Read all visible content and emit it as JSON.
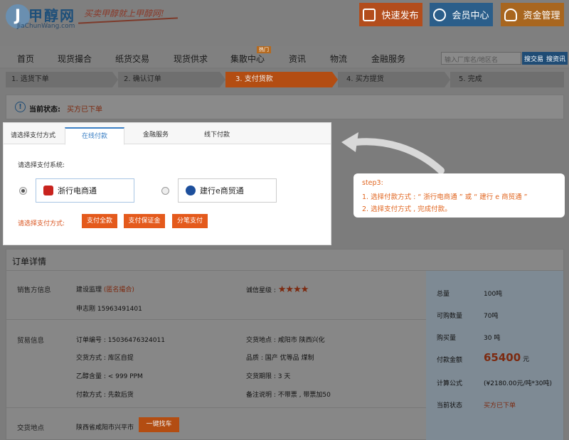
{
  "header": {
    "logo_text": "甲醇网",
    "logo_sub": "JiaChunWang.com",
    "slogan": "买卖甲醇就上甲醇网!",
    "buttons": [
      {
        "label": "快速发布"
      },
      {
        "label": "会员中心"
      },
      {
        "label": "资金管理"
      }
    ]
  },
  "nav": {
    "items": [
      "首页",
      "现货撮合",
      "纸货交易",
      "现货供求",
      "集散中心",
      "资讯",
      "物流",
      "金融服务"
    ],
    "hot_badge": "热门",
    "search_placeholder": "输入厂库名/地区名",
    "search_buttons": [
      "搜交易",
      "搜资讯"
    ]
  },
  "steps": [
    "1. 选货下单",
    "2. 确认订单",
    "3. 支付货款",
    "4. 买方提货",
    "5. 完成"
  ],
  "active_step": 3,
  "status": {
    "label": "当前状态:",
    "value": "买方已下单"
  },
  "payment": {
    "choose_label": "请选择支付方式",
    "tabs": [
      "在线付款",
      "金融服务",
      "线下付款"
    ],
    "active_tab": "在线付款",
    "system_label": "请选择支付系统:",
    "banks": [
      {
        "name": "浙行电商通",
        "selected": true
      },
      {
        "name": "建行e商贸通",
        "selected": false
      }
    ],
    "method_label": "请选择支付方式:",
    "methods": [
      "支付全款",
      "支付保证金",
      "分笔支付"
    ]
  },
  "callout": {
    "title": "step3:",
    "line1": "1. 选择付款方式 : “ 浙行电商通 ”  或  “ 建行 e 商贸通 ”",
    "line2": "2. 选择支付方式 ,  完成付款。"
  },
  "order": {
    "title": "订单详情",
    "seller_label": "销售方信息",
    "seller_company": "建设监理",
    "seller_tag": "(匿名撮合)",
    "seller_contact": "申志刚 15963491401",
    "credit_label": "诚信星级 :",
    "credit_stars": "★★★★",
    "trade_label": "贸易信息",
    "order_no": "订单编号 : 15036476324011",
    "delivery_method": "交货方式 : 库区自提",
    "ethanol": "乙醇含量 : < 999 PPM",
    "payment_method": "付款方式 :  先款后货",
    "delivery_place": "交货地点 : 咸阳市 陕西兴化",
    "quality": "品质 : 国产 优等品 煤制",
    "delivery_period": "交货期限 : 3 天",
    "remark": "备注说明 :  不带票 , 带票加50",
    "location_label": "交货地点",
    "location_value": "陕西省咸阳市兴平市",
    "find_car": "一键找车",
    "summary": {
      "total_label": "总量",
      "total_value": "100吨",
      "avail_label": "可购数量",
      "avail_value": "70吨",
      "buy_label": "购买量",
      "buy_value": "30 吨",
      "amount_label": "付款金额",
      "amount_value": "65400",
      "amount_unit": "元",
      "formula_label": "计算公式",
      "formula_value": "(¥2180.00元/吨*30吨)",
      "state_label": "当前状态",
      "state_value": "买方已下单"
    }
  },
  "colors": {
    "accent_orange": "#e45a1c",
    "link_blue": "#3b7fc4",
    "dim_overlay": "#808080"
  }
}
